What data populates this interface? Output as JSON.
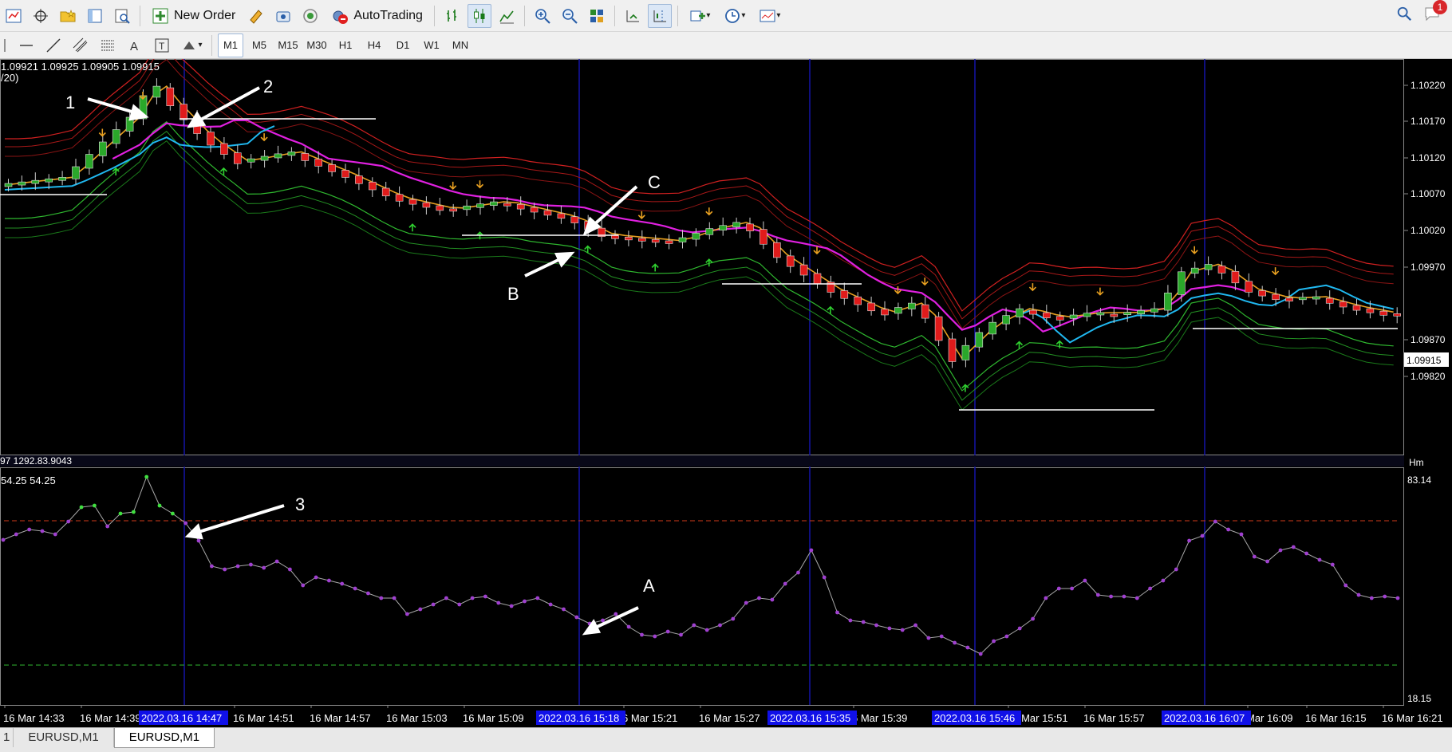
{
  "toolbar": {
    "new_order_label": "New Order",
    "autotrading_label": "AutoTrading",
    "notification_count": "1",
    "timeframes": [
      "M1",
      "M5",
      "M15",
      "M30",
      "H1",
      "H4",
      "D1",
      "W1",
      "MN"
    ],
    "active_timeframe": "M1"
  },
  "chart": {
    "ohlc_text": "1.09921 1.09925 1.09905 1.09915",
    "period_text": "/20)",
    "indicator_values_text": "54.25 54.25",
    "indicator_scale_top": "83.14",
    "indicator_scale_bottom": "18.15",
    "indicator_header_text": "97 1292.83.9043",
    "current_price": "1.09915",
    "price_levels": [
      "1.10220",
      "1.10170",
      "1.10120",
      "1.10070",
      "1.10020",
      "1.09970",
      "1.09870",
      "1.09820"
    ],
    "time_labels": [
      "16 Mar 14:33",
      "16 Mar 14:39",
      "16 Mar 14:51",
      "16 Mar 14:57",
      "16 Mar 15:03",
      "16 Mar 15:09",
      "6 Mar 15:21",
      "16 Mar 15:27",
      "6 Mar 15:39",
      "16 Mar 15:51",
      "16 Mar 15:57",
      "Mar 16:09",
      "16 Mar 16:15",
      "16 Mar 16:21"
    ],
    "highlighted_times": [
      "2022.03.16 14:47",
      "2022.03.16 15:18",
      "2022.03.16 15:35",
      "2022.03.16 15:46",
      "2022.03.16 16:07"
    ],
    "annotations": [
      "1",
      "2",
      "C",
      "B",
      "3",
      "A"
    ],
    "colors": {
      "bull": "#2aa82a",
      "bear": "#e01b1b",
      "magenta_ma": "#e020e0",
      "cyan_ma": "#20b8f0",
      "oscillator": "#a8a8a8",
      "upper_level": "#d03a1a",
      "lower_level": "#2fb82f",
      "vertical_markers": "#1414a8"
    }
  },
  "tabs": [
    "EURUSD,M1",
    "EURUSD,M1"
  ],
  "active_tab": 1
}
